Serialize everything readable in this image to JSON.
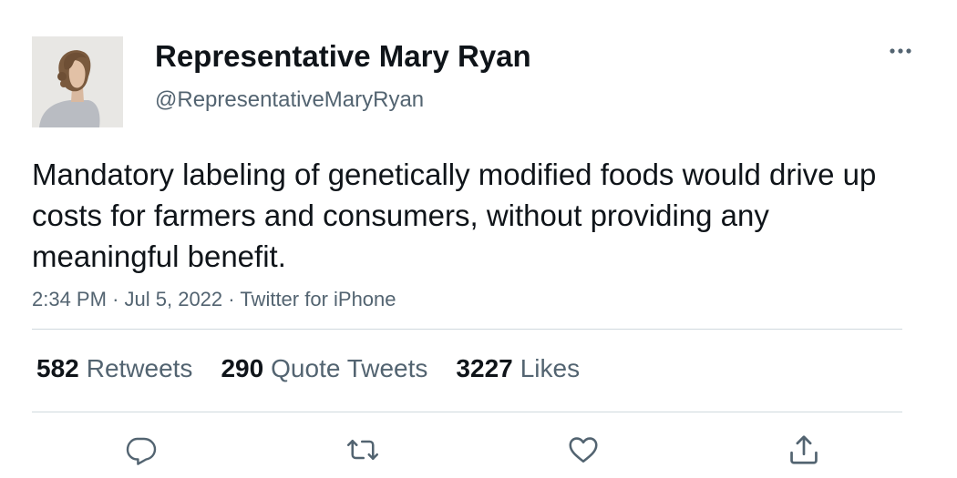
{
  "author": {
    "display_name": "Representative Mary Ryan",
    "handle": "@RepresentativeMaryRyan",
    "avatar_icon": "profile-photo"
  },
  "tweet": {
    "text": "Mandatory labeling of genetically modified foods would drive up costs for farmers and consumers, without providing any meaningful benefit.",
    "time": "2:34 PM",
    "separator": "·",
    "date": "Jul 5, 2022",
    "source": "Twitter for iPhone"
  },
  "stats": {
    "retweets_count": "582",
    "retweets_label": "Retweets",
    "quotes_count": "290",
    "quotes_label": "Quote Tweets",
    "likes_count": "3227",
    "likes_label": "Likes"
  },
  "actions": [
    {
      "name": "reply",
      "icon": "reply-icon"
    },
    {
      "name": "retweet",
      "icon": "retweet-icon"
    },
    {
      "name": "like",
      "icon": "heart-icon"
    },
    {
      "name": "share",
      "icon": "share-icon"
    }
  ],
  "colors": {
    "text_primary": "#0f1419",
    "text_secondary": "#536471",
    "divider": "#cfd9de",
    "background": "#ffffff"
  }
}
